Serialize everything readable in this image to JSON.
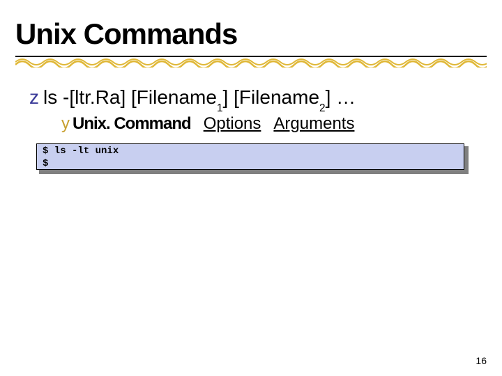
{
  "title": "Unix Commands",
  "bullet1": {
    "marker": "z",
    "text_pre": "ls -[ltr.Ra] [Filename",
    "sub1": "1",
    "mid": "] [Filename",
    "sub2": "2",
    "tail": "] …"
  },
  "bullet2": {
    "marker": "y",
    "cmd": "Unix. Command",
    "options": "Options",
    "arguments": "Arguments"
  },
  "code": "$ ls -lt unix\n$",
  "page_number": "16",
  "colors": {
    "bullet1_marker": "#3b3b99",
    "bullet2_marker": "#c8a030",
    "codebox_bg": "#c8cff0",
    "shadow": "#808080",
    "scribble": "#e0b838"
  }
}
